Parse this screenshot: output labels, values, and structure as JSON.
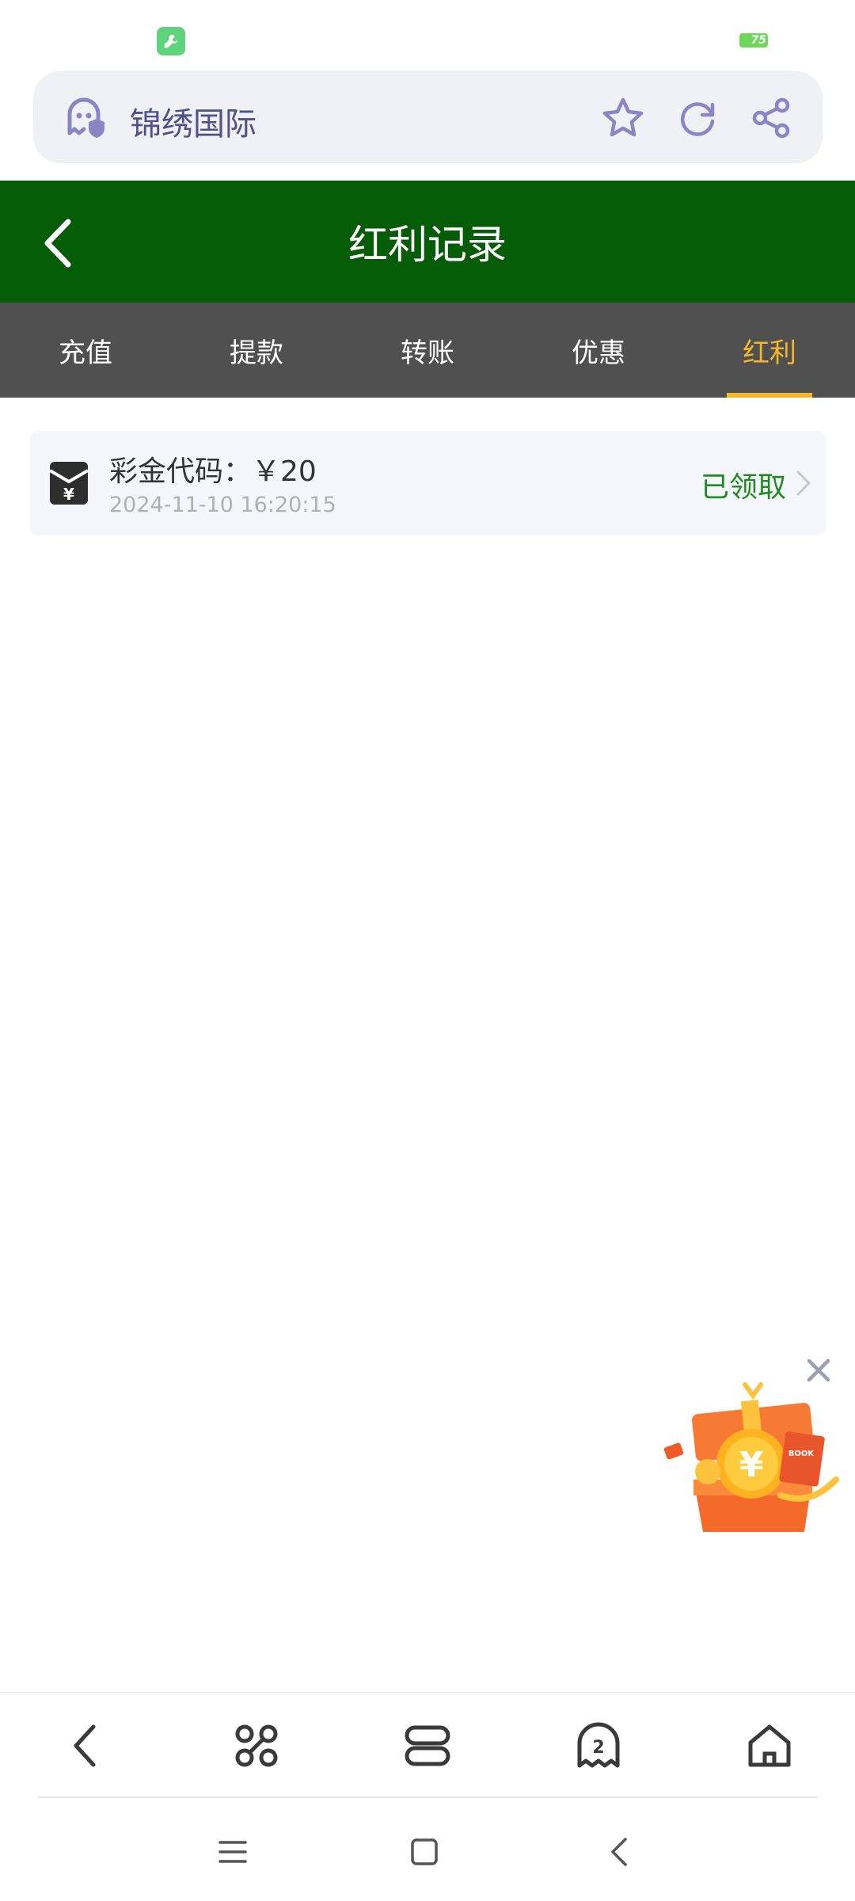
{
  "browser": {
    "site_title": "锦绣国际"
  },
  "header": {
    "title": "红利记录"
  },
  "tabs": [
    {
      "label": "充值",
      "active": false
    },
    {
      "label": "提款",
      "active": false
    },
    {
      "label": "转账",
      "active": false
    },
    {
      "label": "优惠",
      "active": false
    },
    {
      "label": "红利",
      "active": true
    }
  ],
  "records": [
    {
      "title": "彩金代码：￥20",
      "date": "2024-11-10 16:20:15",
      "status": "已领取"
    }
  ],
  "browser_nav": {
    "tab_count": "2"
  },
  "status_bar": {
    "battery": "75"
  },
  "colors": {
    "header_bg": "#055c06",
    "tab_bar_bg": "#505050",
    "tab_active": "#f5b82c",
    "status_received": "#1e8c1e"
  }
}
